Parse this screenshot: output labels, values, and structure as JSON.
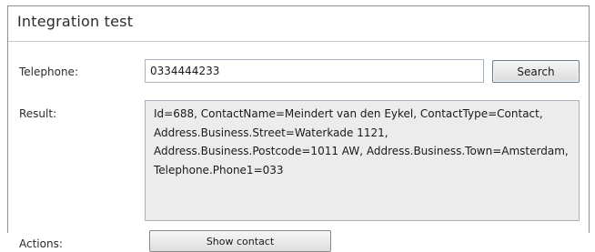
{
  "panel": {
    "title": "Integration test"
  },
  "form": {
    "telephone_label": "Telephone:",
    "telephone_value": "0334444233",
    "search_label": "Search",
    "result_label": "Result:",
    "result_text": "Id=688, ContactName=Meindert van den Eykel, ContactType=Contact, Address.Business.Street=Waterkade 1121, Address.Business.Postcode=1011 AW, Address.Business.Town=Amsterdam, Telephone.Phone1=033",
    "actions_label": "Actions:",
    "show_contact_label": "Show contact"
  }
}
